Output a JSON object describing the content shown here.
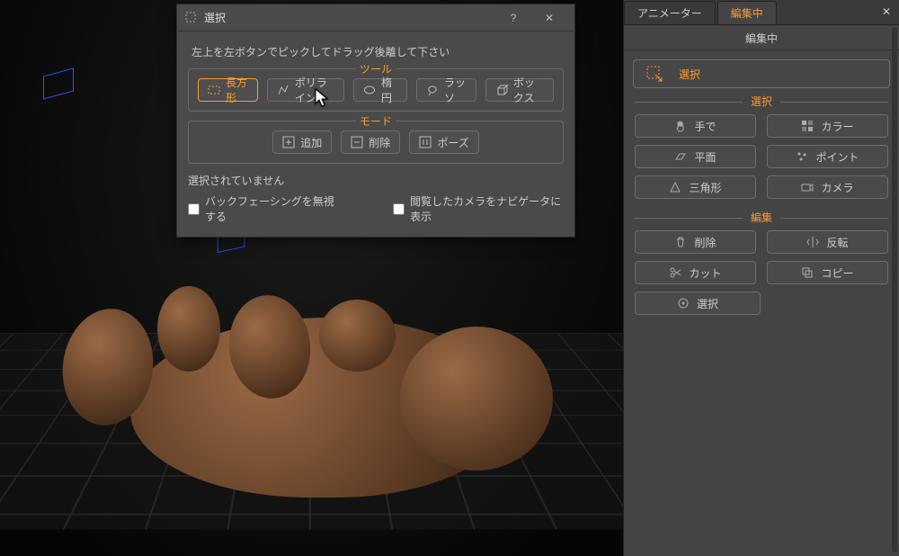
{
  "modal": {
    "title": "選択",
    "help_symbol": "?",
    "close_symbol": "✕",
    "hint": "左上を左ボタンでピックしてドラッグ後離して下さい",
    "tool_group_label": "ツール",
    "tools": {
      "rect": "長方形",
      "polyline": "ポリライン",
      "ellipse": "楕円",
      "lasso": "ラッソ",
      "box": "ボックス"
    },
    "mode_group_label": "モード",
    "modes": {
      "add": "追加",
      "remove": "削除",
      "pause": "ポーズ"
    },
    "status": "選択されていません",
    "check_backface": "バックフェーシングを無視する",
    "check_showcam": "閲覧したカメラをナビゲータに表示"
  },
  "right": {
    "tab_animator": "アニメーター",
    "tab_editing": "編集中",
    "header": "編集中",
    "big_select": "選択",
    "section_select": "選択",
    "btn_hand": "手で",
    "btn_color": "カラー",
    "btn_plane": "平面",
    "btn_point": "ポイント",
    "btn_tri": "三角形",
    "btn_camera": "カメラ",
    "section_edit": "編集",
    "btn_delete": "削除",
    "btn_flip": "反転",
    "btn_cut": "カット",
    "btn_copy": "コピー",
    "btn_select": "選択"
  }
}
